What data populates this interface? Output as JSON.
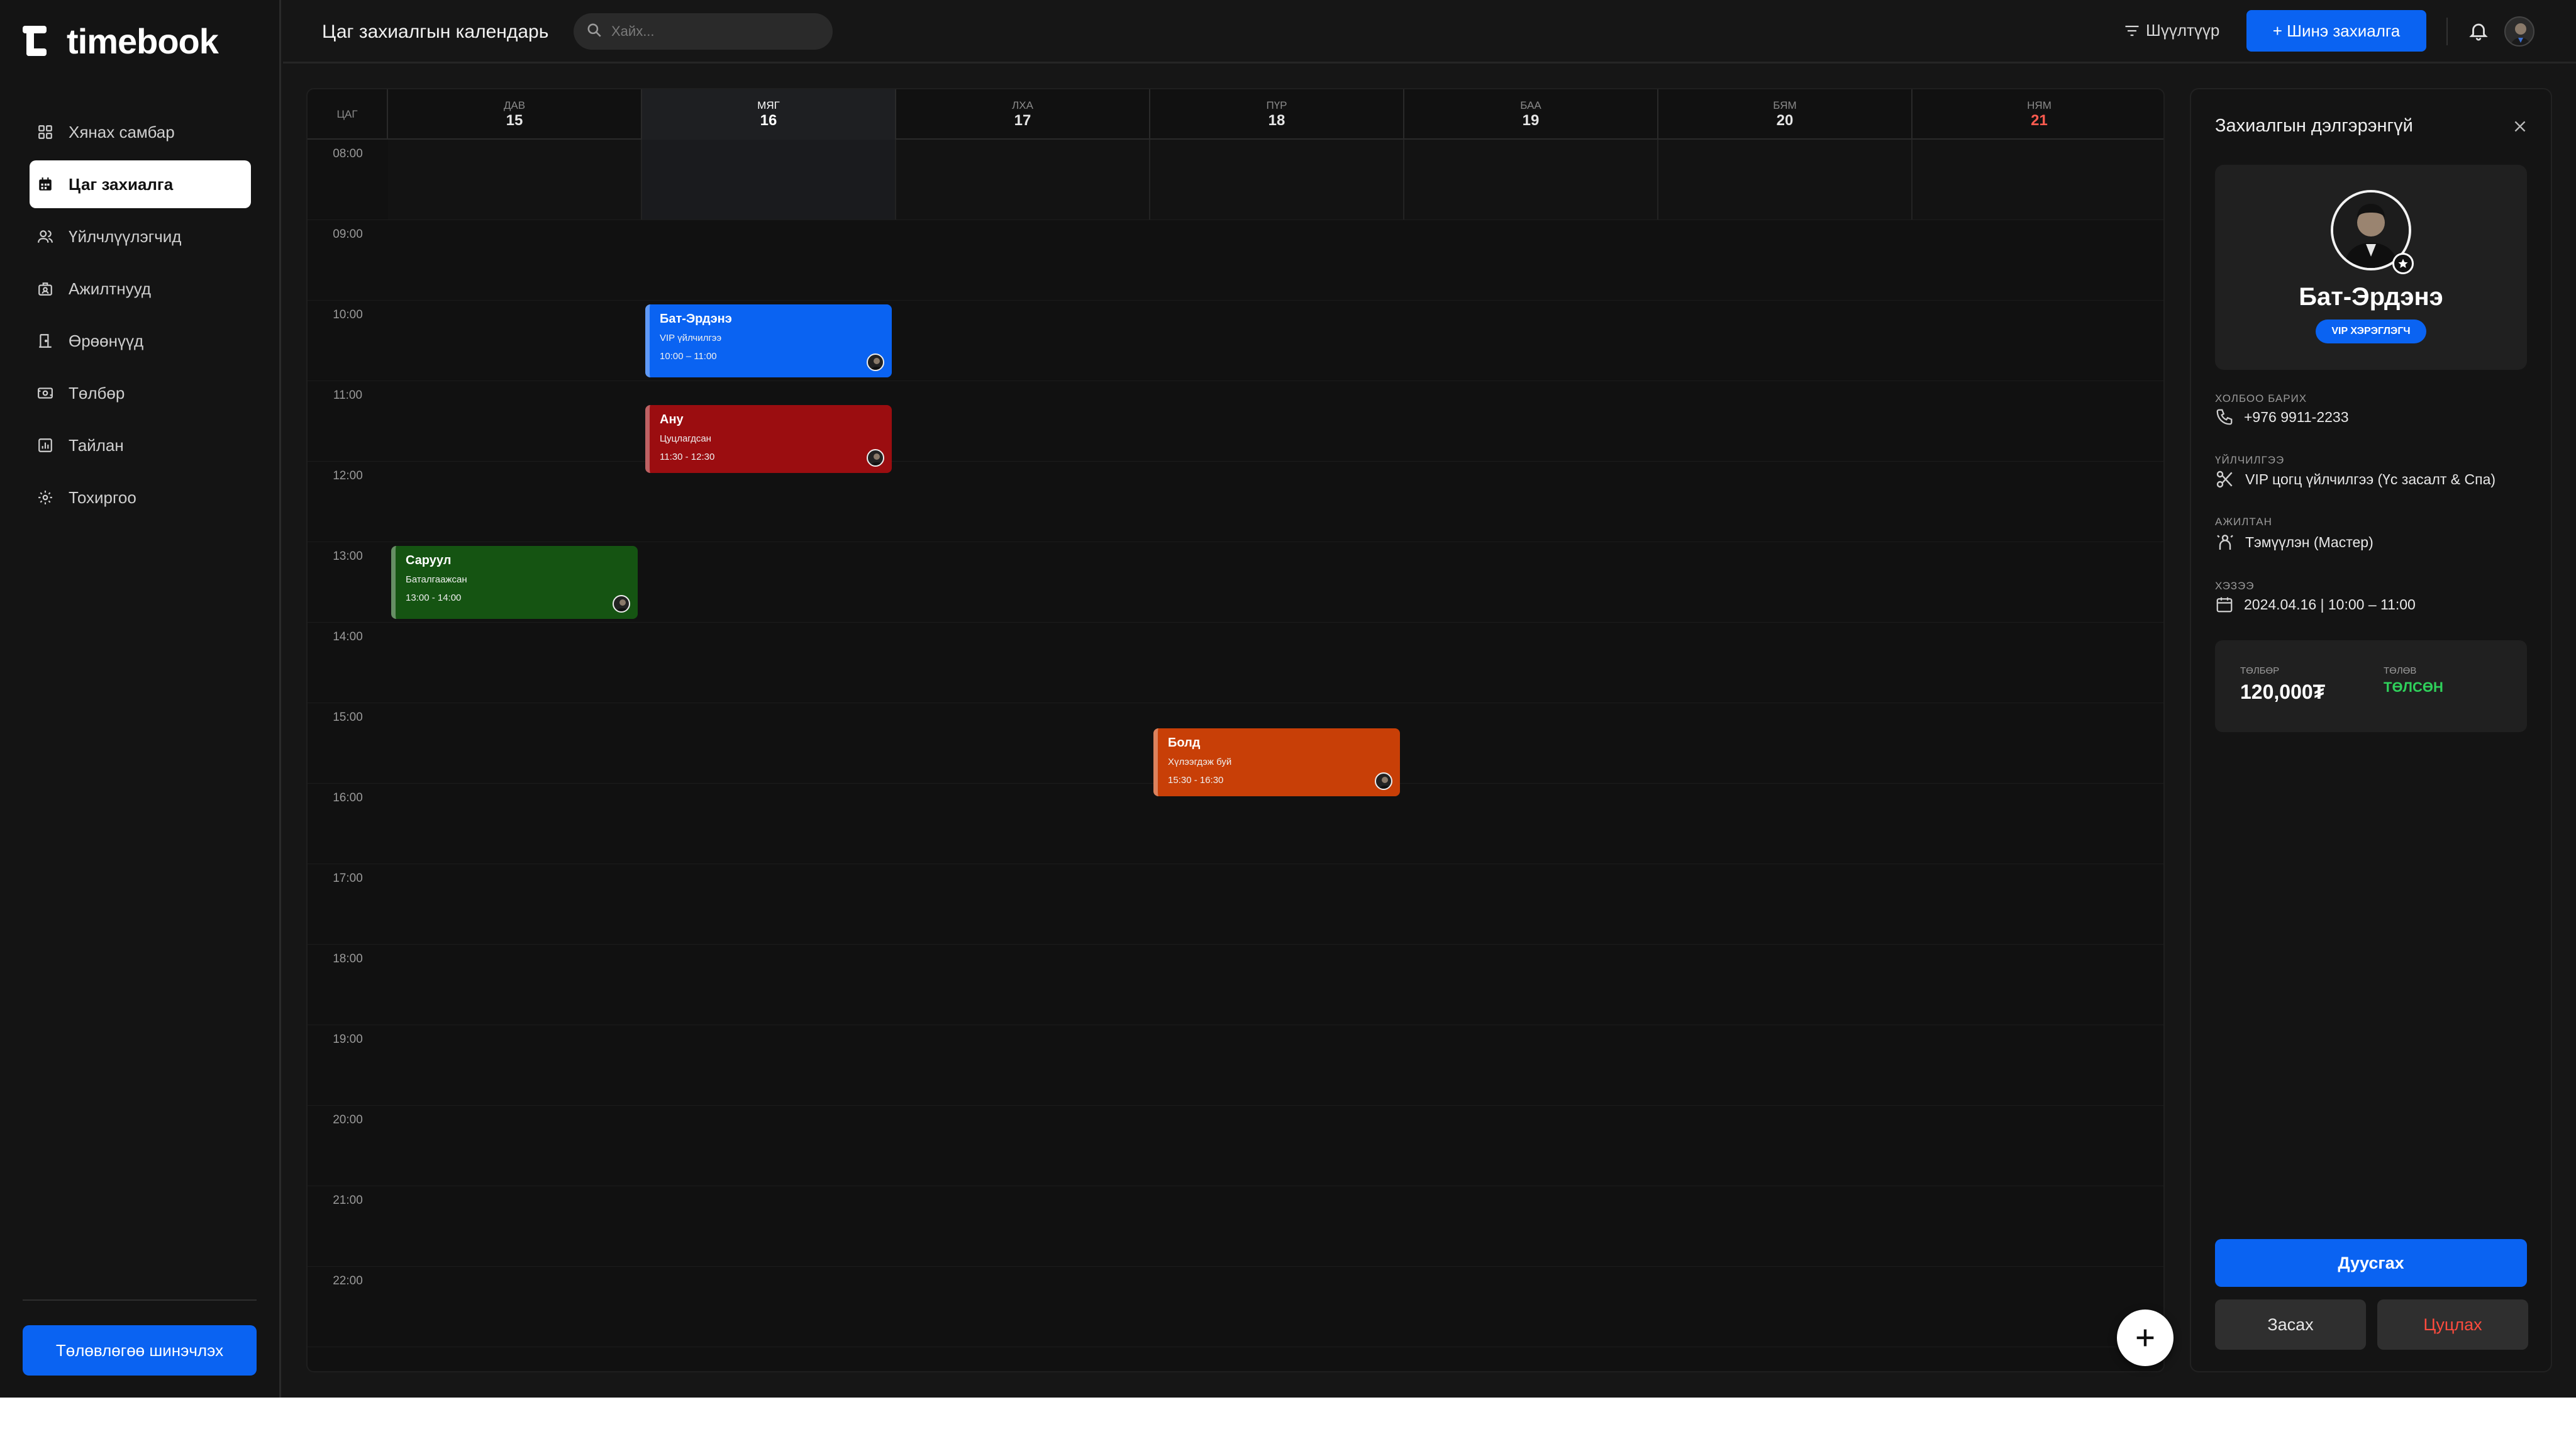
{
  "brand": {
    "name": "timebook"
  },
  "sidebar": {
    "items": [
      {
        "label": "Хянах самбар",
        "icon": "dashboard-icon"
      },
      {
        "label": "Цаг захиалга",
        "icon": "calendar-icon",
        "active": true
      },
      {
        "label": "Үйлчлүүлэгчид",
        "icon": "users-icon"
      },
      {
        "label": "Ажилтнууд",
        "icon": "staff-icon"
      },
      {
        "label": "Өрөөнүүд",
        "icon": "door-icon"
      },
      {
        "label": "Төлбөр",
        "icon": "payment-icon"
      },
      {
        "label": "Тайлан",
        "icon": "report-icon"
      },
      {
        "label": "Тохиргоо",
        "icon": "settings-icon"
      }
    ],
    "upgrade_label": "Төлөвлөгөө шинэчлэх"
  },
  "header": {
    "title": "Цаг захиалгын календарь",
    "search_placeholder": "Хайх...",
    "filter_label": "Шүүлтүүр",
    "new_booking_label": "+ Шинэ захиалга"
  },
  "calendar": {
    "time_col_label": "ЦАГ",
    "days": [
      {
        "name": "ДАВ",
        "num": "15"
      },
      {
        "name": "МЯГ",
        "num": "16",
        "today": true
      },
      {
        "name": "ЛХА",
        "num": "17"
      },
      {
        "name": "ПҮР",
        "num": "18"
      },
      {
        "name": "БАА",
        "num": "19"
      },
      {
        "name": "БЯМ",
        "num": "20"
      },
      {
        "name": "НЯМ",
        "num": "21",
        "sunday": true
      }
    ],
    "hours": [
      "08:00",
      "09:00",
      "10:00",
      "11:00",
      "12:00",
      "13:00",
      "14:00",
      "15:00",
      "16:00",
      "17:00",
      "18:00",
      "19:00",
      "20:00",
      "21:00",
      "22:00"
    ],
    "events": [
      {
        "name": "Бат-Эрдэнэ",
        "sub": "VIP үйлчилгээ",
        "time": "10:00 – 11:00",
        "color": "#0a63f2"
      },
      {
        "name": "Ану",
        "sub": "Цуцлагдсан",
        "time": "11:30 - 12:30",
        "color": "#9b0d10"
      },
      {
        "name": "Саруул",
        "sub": "Баталгаажсан",
        "time": "13:00 - 14:00",
        "color": "#155412"
      },
      {
        "name": "Болд",
        "sub": "Хүлээгдэж буй",
        "time": "15:30 - 16:30",
        "color": "#c83f07"
      }
    ]
  },
  "details": {
    "title": "Захиалгын дэлгэрэнгүй",
    "customer_name": "Бат-Эрдэнэ",
    "badge": "VIP ХЭРЭГЛЭГЧ",
    "contact_label": "ХОЛБОО БАРИХ",
    "contact_value": "+976 9911-2233",
    "service_label": "ҮЙЛЧИЛГЭЭ",
    "service_value": "VIP цогц үйлчилгээ (Үс засалт & Спа)",
    "staff_label": "АЖИЛТАН",
    "staff_value": "Тэмүүлэн (Мастер)",
    "date_label": "ХЭЗЭЭ",
    "date_value": "2024.04.16 | 10:00 – 11:00",
    "payment_label": "ТӨЛБӨР",
    "payment_amount": "120,000₮",
    "status_label": "ТӨЛӨВ",
    "status_value": "ТӨЛСӨН",
    "finish_label": "Дуусгах",
    "edit_label": "Засах",
    "cancel_label": "Цуцлах"
  },
  "colors": {
    "accent": "#0a63f2",
    "danger": "#ff4b3e",
    "success": "#2fd05b"
  }
}
